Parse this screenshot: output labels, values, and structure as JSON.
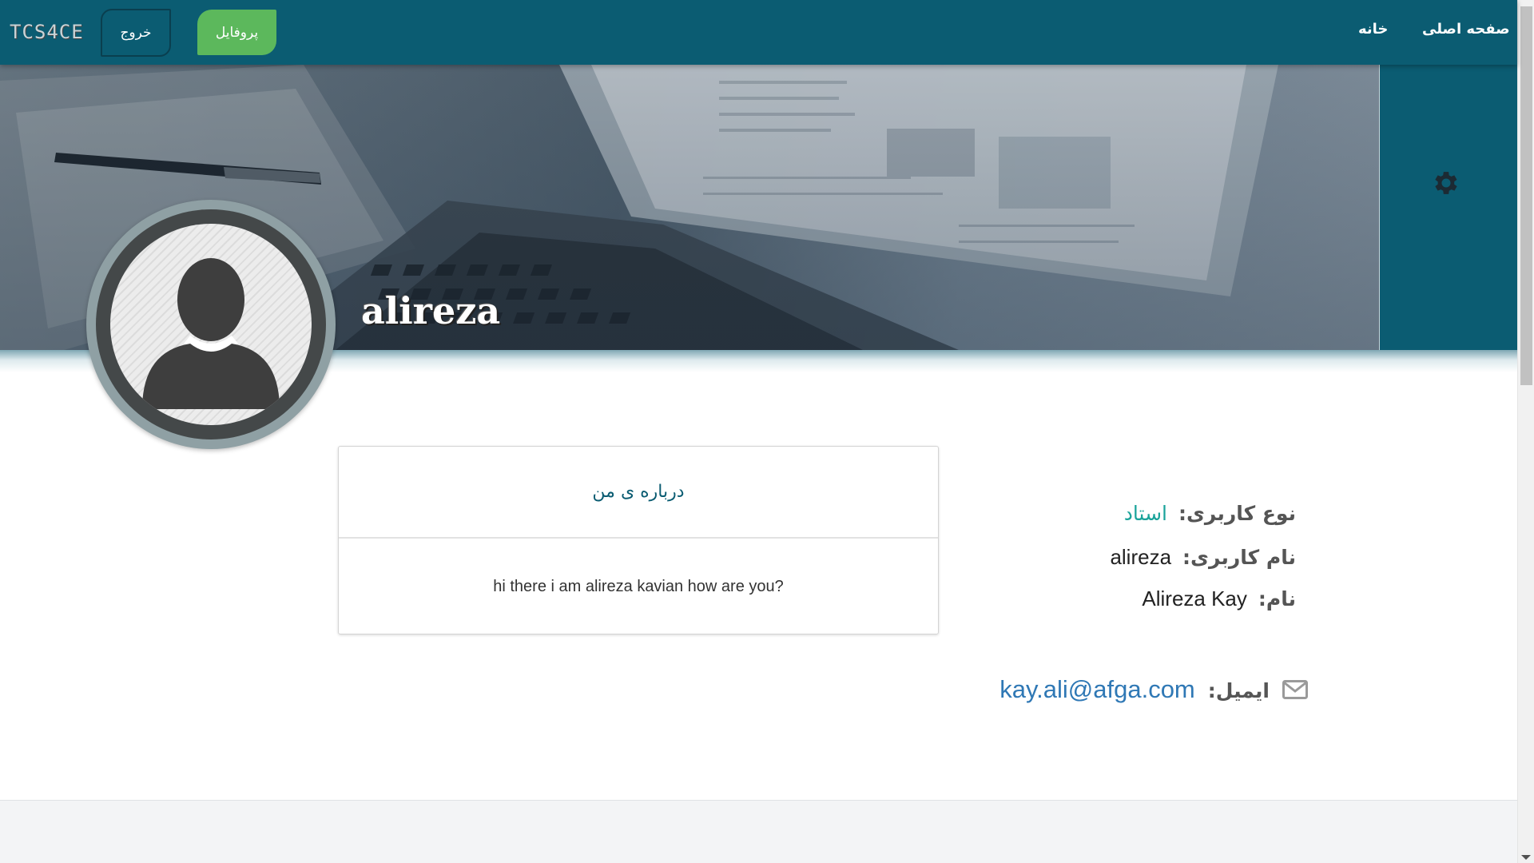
{
  "navbar": {
    "brand": "TCS4CE",
    "logout_label": "خروج",
    "profile_label": "پروفایل",
    "home_label": "خانه",
    "main_page_label": "صفحه اصلی"
  },
  "profile": {
    "username_display": "alireza",
    "about_title": "درباره ی من",
    "about_text": "hi there i am alireza kavian how are you?"
  },
  "info": {
    "type_label": "نوع کاربری:",
    "type_value": "استاد",
    "username_label": "نام کاربری:",
    "username_value": "alireza",
    "name_label": "نام:",
    "name_value": "Alireza Kay",
    "email_label": "ایمیل:",
    "email_value": "kay.ali@afga.com"
  },
  "icons": {
    "settings": "gear-icon",
    "email": "envelope-icon",
    "avatar": "user-avatar-icon"
  },
  "colors": {
    "navbar": "#0b5c72",
    "profile_button": "#5cb85c",
    "user_type": "#1aa39a",
    "email_link": "#2f78b5"
  }
}
